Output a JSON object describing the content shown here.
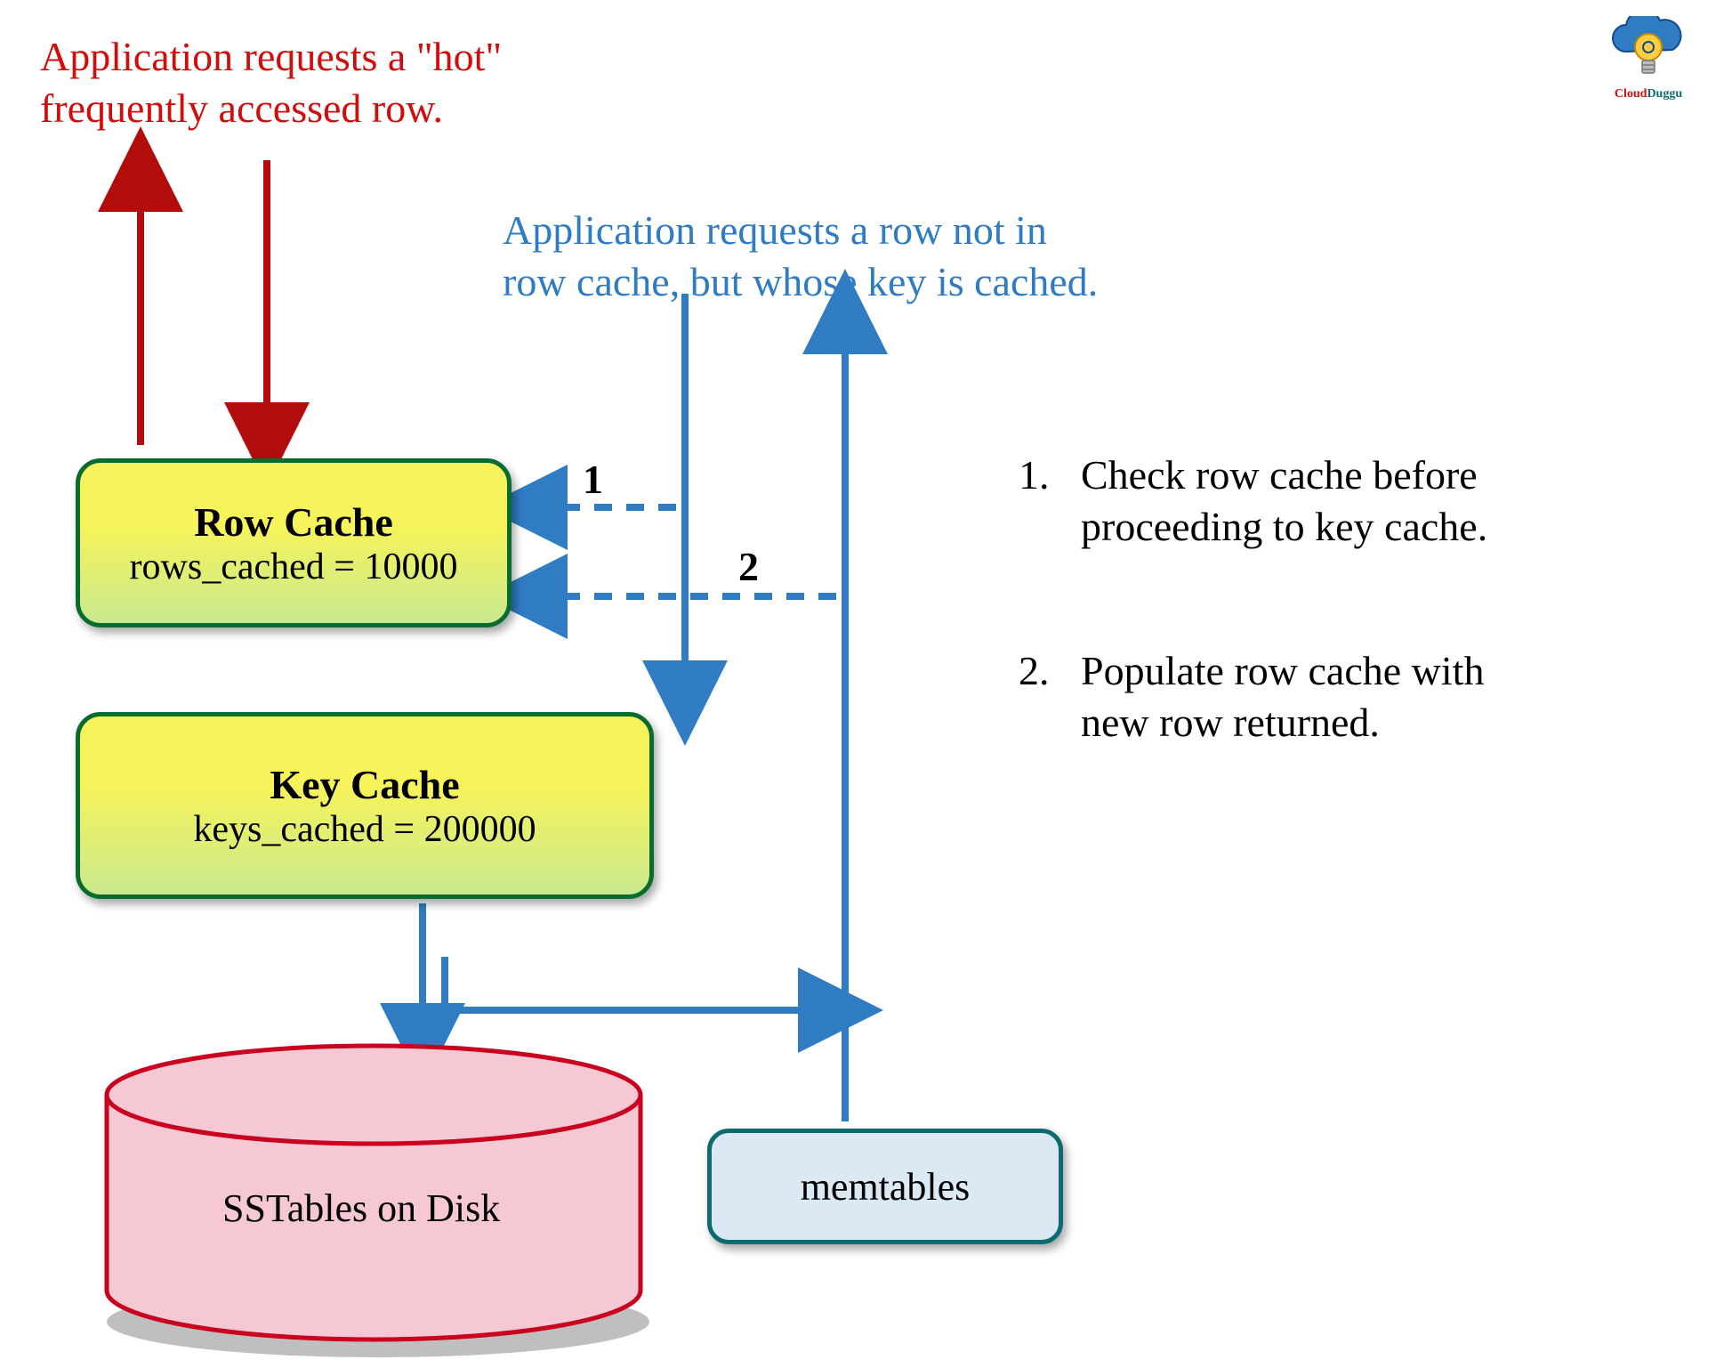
{
  "captions": {
    "red_hot_row": "Application requests a \"hot\"\nfrequently accessed row.",
    "blue_key_cached": "Application requests a row not in\nrow cache, but whose key is cached."
  },
  "steps": {
    "label1": "1",
    "label2": "2",
    "step1": "Check row cache before\nproceeding to key cache.",
    "step2": "Populate row cache with\nnew row returned.",
    "list_prefix1": "1.",
    "list_prefix2": "2."
  },
  "boxes": {
    "row_cache": {
      "title": "Row Cache",
      "sub": "rows_cached = 10000"
    },
    "key_cache": {
      "title": "Key Cache",
      "sub": "keys_cached = 200000"
    },
    "memtables": "memtables",
    "sstables": "SSTables on Disk"
  },
  "logo": {
    "brand_left": "Cloud",
    "brand_right": "Duggu"
  },
  "colors": {
    "red": "#d10c0c",
    "blue": "#2f7cc3",
    "green_border": "#0a6b2f",
    "teal_border": "#0d6a6f",
    "pink_fill": "#f6c8d3",
    "pink_stroke": "#c9001e"
  }
}
